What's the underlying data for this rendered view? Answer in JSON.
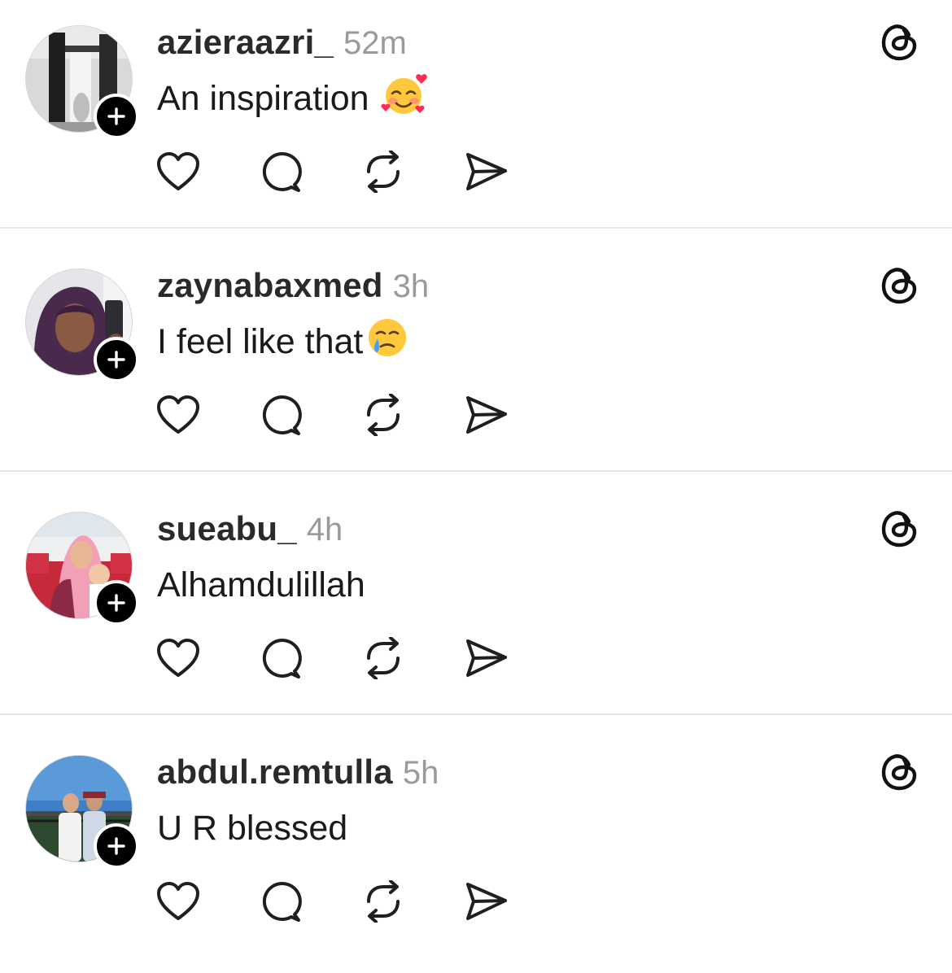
{
  "replies": [
    {
      "username": "azieraazri_",
      "time": "52m",
      "text": "An inspiration",
      "emoji": "smiling-face-with-hearts"
    },
    {
      "username": "zaynabaxmed",
      "time": "3h",
      "text": "I feel like that",
      "emoji": "smiling-face-with-tear"
    },
    {
      "username": "sueabu_",
      "time": "4h",
      "text": "Alhamdulillah",
      "emoji": ""
    },
    {
      "username": "abdul.remtulla",
      "time": "5h",
      "text": "U R blessed",
      "emoji": ""
    }
  ],
  "icons": {
    "follow": "plus-icon",
    "like": "heart-icon",
    "reply": "comment-bubble-icon",
    "repost": "repost-icon",
    "share": "send-icon",
    "brand": "threads-logo-icon"
  },
  "colors": {
    "username": "#2a2a2a",
    "timestamp": "#9a9a9a",
    "divider": "#e6e6e6",
    "icon": "#1f1f1f"
  }
}
